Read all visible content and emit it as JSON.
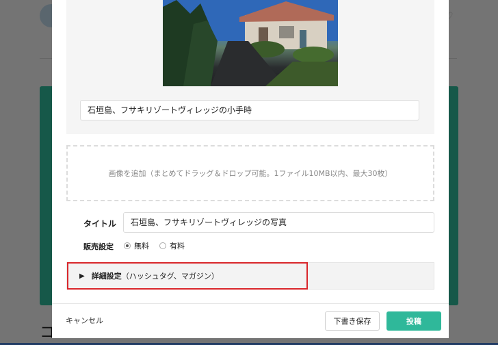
{
  "background": {
    "partial_text": "コ"
  },
  "modal": {
    "photo_alt": "石垣島、フサキリゾートヴィレッジの小手時",
    "caption_value": "石垣島、フサキリゾートヴィレッジの小手時",
    "dropzone_text": "画像を追加（まとめてドラッグ＆ドロップ可能。1ファイル10MB以内、最大30枚）",
    "title_label": "タイトル",
    "title_value": "石垣島、フサキリゾートヴィレッジの写真",
    "sale_label": "販売設定",
    "sale_options": [
      {
        "label": "無料",
        "selected": true
      },
      {
        "label": "有料",
        "selected": false
      }
    ],
    "details_label_bold": "詳細設定",
    "details_label_rest": "（ハッシュタグ、マガジン）",
    "cancel_label": "キャンセル",
    "draft_label": "下書き保存",
    "post_label": "投稿"
  },
  "colors": {
    "accent": "#2fb89a",
    "highlight_border": "#d9262b"
  },
  "icons": {
    "details_toggle": "triangle-right-icon",
    "heart": "heart-icon"
  }
}
